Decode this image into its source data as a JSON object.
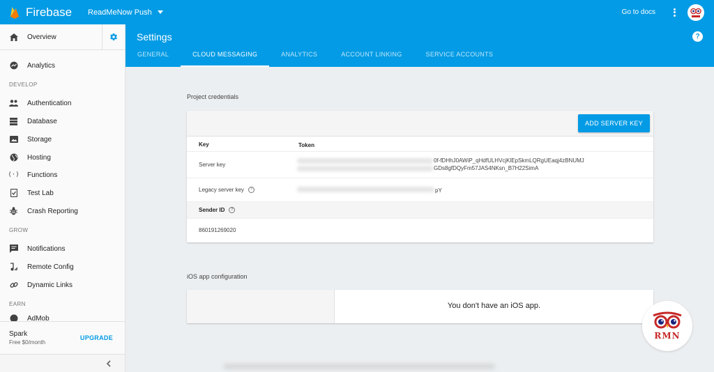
{
  "topbar": {
    "brand": "Firebase",
    "project": "ReadMeNow Push",
    "docs_link": "Go to docs",
    "icons": [
      "firebase-logo-icon",
      "caret-down-icon",
      "more-vert-icon",
      "avatar-icon"
    ]
  },
  "sidebar": {
    "overview": "Overview",
    "analytics": "Analytics",
    "sections": {
      "develop": "DEVELOP",
      "grow": "GROW",
      "earn": "EARN"
    },
    "develop_items": [
      {
        "label": "Authentication",
        "icon": "people-icon"
      },
      {
        "label": "Database",
        "icon": "database-icon"
      },
      {
        "label": "Storage",
        "icon": "storage-icon"
      },
      {
        "label": "Hosting",
        "icon": "globe-icon"
      },
      {
        "label": "Functions",
        "icon": "functions-icon"
      },
      {
        "label": "Test Lab",
        "icon": "checklist-icon"
      },
      {
        "label": "Crash Reporting",
        "icon": "bug-icon"
      }
    ],
    "grow_items": [
      {
        "label": "Notifications",
        "icon": "chat-icon"
      },
      {
        "label": "Remote Config",
        "icon": "music-note-icon"
      },
      {
        "label": "Dynamic Links",
        "icon": "link-icon"
      }
    ],
    "earn_partial": "AdMob",
    "plan": {
      "name": "Spark",
      "price": "Free $0/month",
      "upgrade": "UPGRADE"
    }
  },
  "header": {
    "title": "Settings",
    "tabs": [
      "GENERAL",
      "CLOUD MESSAGING",
      "ANALYTICS",
      "ACCOUNT LINKING",
      "SERVICE ACCOUNTS"
    ],
    "active_tab": "CLOUD MESSAGING"
  },
  "credentials": {
    "section_title": "Project credentials",
    "add_button": "ADD SERVER KEY",
    "columns": {
      "key": "Key",
      "token": "Token"
    },
    "server_key": {
      "label": "Server key",
      "line1": "0f-fDHhJ0AWiP_qHdfULHVcjKlEpSkmLQRgUEaqj4zBNUMJ",
      "line2": "GDs8gfDQyFm57JAS4NKsn_B7H22SimA"
    },
    "legacy_key": {
      "label": "Legacy server key",
      "suffix": "pY"
    },
    "sender_id": {
      "label": "Sender ID",
      "value": "860191269020"
    }
  },
  "ios": {
    "section_title": "iOS app configuration",
    "message": "You don't have an iOS app."
  },
  "watermark": {
    "text": "RMN"
  },
  "colors": {
    "primary": "#039be5",
    "accent_red": "#c62828",
    "background": "#eceff1"
  }
}
